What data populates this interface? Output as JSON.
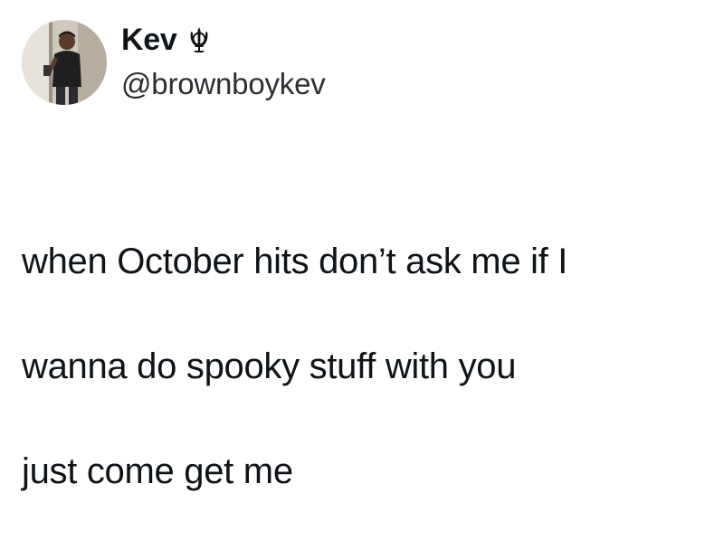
{
  "author": {
    "display_name": "Kev",
    "handle": "@brownboykev",
    "badge_icon": "khanda-icon"
  },
  "tweet": {
    "lines": [
      "when October hits don’t ask me if I",
      "wanna do spooky stuff with you",
      "just come get me"
    ]
  },
  "colors": {
    "text": "#0f1419",
    "handle": "#2b2f33",
    "background": "#ffffff"
  }
}
